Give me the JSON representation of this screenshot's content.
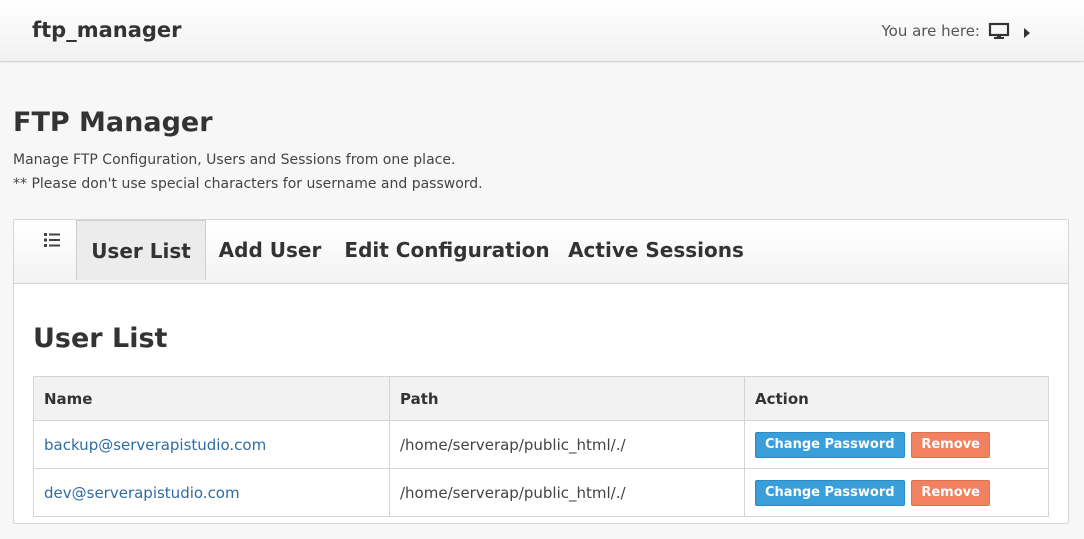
{
  "header": {
    "app_title": "ftp_manager",
    "breadcrumb_label": "You are here:"
  },
  "page": {
    "title": "FTP Manager",
    "description_line1": "Manage FTP Configuration, Users and Sessions from one place.",
    "description_line2": "** Please don't use special characters for username and password."
  },
  "tabs": [
    {
      "label": "User List",
      "active": true
    },
    {
      "label": "Add User",
      "active": false
    },
    {
      "label": "Edit Configuration",
      "active": false
    },
    {
      "label": "Active Sessions",
      "active": false
    }
  ],
  "user_list": {
    "title": "User List",
    "columns": [
      "Name",
      "Path",
      "Action"
    ],
    "rows": [
      {
        "name": "backup@serverapistudio.com",
        "path": "/home/serverap/public_html/./"
      },
      {
        "name": "dev@serverapistudio.com",
        "path": "/home/serverap/public_html/./"
      }
    ],
    "change_password_label": "Change Password",
    "remove_label": "Remove"
  },
  "icons": {
    "breadcrumb_home": "monitor-icon",
    "breadcrumb_separator": "caret-right-icon",
    "tab_menu": "list-icon"
  },
  "colors": {
    "link": "#2e6da4",
    "change_password_button": "#3a9fd8",
    "remove_button": "#f08262"
  }
}
